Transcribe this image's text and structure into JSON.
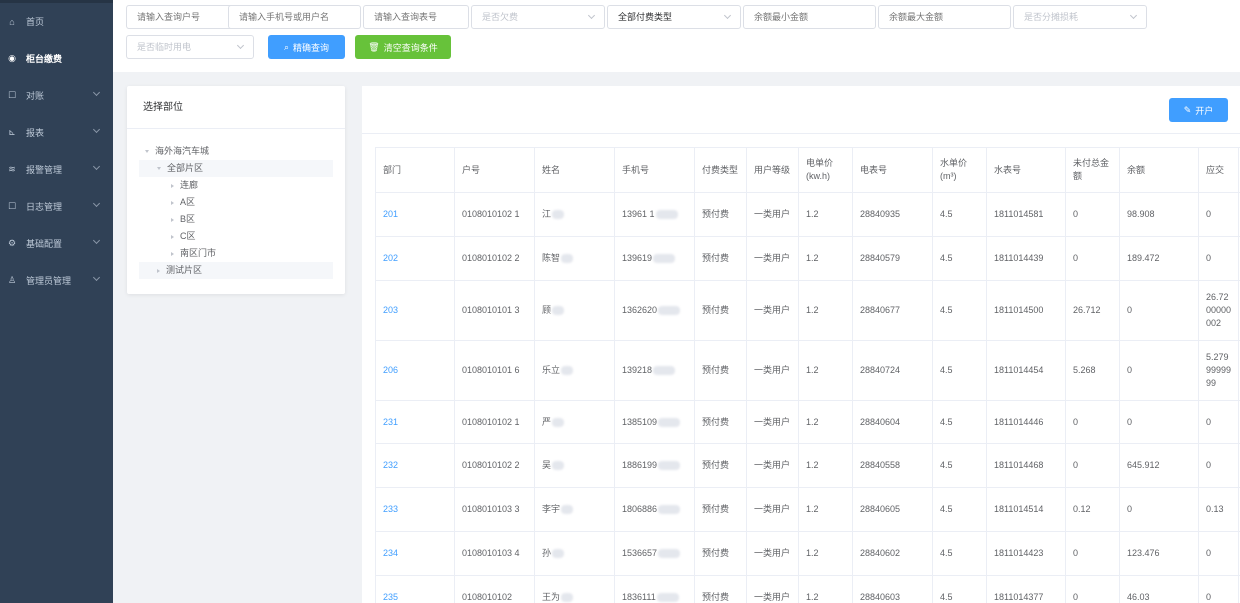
{
  "sidebar": {
    "items": [
      {
        "label": "首页",
        "icon": "dashboard-icon",
        "glyph": "⌂",
        "has_arrow": false,
        "active": false
      },
      {
        "label": "柜台缴费",
        "icon": "counter-icon",
        "glyph": "◉",
        "has_arrow": false,
        "active": true
      },
      {
        "label": "对账",
        "icon": "reconcile-icon",
        "glyph": "☐",
        "has_arrow": true,
        "active": false
      },
      {
        "label": "报表",
        "icon": "report-icon",
        "glyph": "⊾",
        "has_arrow": true,
        "active": false
      },
      {
        "label": "报警管理",
        "icon": "alarm-icon",
        "glyph": "≋",
        "has_arrow": true,
        "active": false
      },
      {
        "label": "日志管理",
        "icon": "log-icon",
        "glyph": "☐",
        "has_arrow": true,
        "active": false
      },
      {
        "label": "基础配置",
        "icon": "config-icon",
        "glyph": "⚙",
        "has_arrow": true,
        "active": false
      },
      {
        "label": "管理员管理",
        "icon": "admin-icon",
        "glyph": "♙",
        "has_arrow": true,
        "active": false
      }
    ]
  },
  "filters": {
    "account_no_placeholder": "请输入查询户号",
    "phone_name_placeholder": "请输入手机号或用户名",
    "meter_no_placeholder": "请输入查询表号",
    "arrears_placeholder": "是否欠费",
    "pay_type_value": "全部付费类型",
    "min_balance_placeholder": "余额最小金额",
    "max_balance_placeholder": "余额最大金额",
    "share_loss_placeholder": "是否分摊损耗",
    "temp_power_placeholder": "是否临时用电",
    "search_label": "精确查询",
    "clear_label": "清空查询条件"
  },
  "tree": {
    "title": "选择部位",
    "root": "海外海汽车城",
    "all_zones": "全部片区",
    "children": [
      "连廊",
      "A区",
      "B区",
      "C区",
      "南区门市"
    ],
    "test_zone": "测试片区"
  },
  "main": {
    "open_account_label": "开户"
  },
  "table": {
    "headers": [
      "部门",
      "户号",
      "姓名",
      "手机号",
      "付费类型",
      "用户等级",
      "电单价(kw.h)",
      "电表号",
      "水单价(m³)",
      "水表号",
      "未付总金额",
      "余额",
      "应交"
    ],
    "rows": [
      {
        "dept": "201",
        "account": "0108010102  1",
        "name": "江",
        "phone": "13961      1",
        "pay_type": "预付费",
        "level": "一类用户",
        "e_price": "1.2",
        "e_meter": "28840935",
        "w_price": "4.5",
        "w_meter": "1811014581",
        "unpaid": "0",
        "balance": "98.908",
        "due": "0"
      },
      {
        "dept": "202",
        "account": "0108010102  2",
        "name": "陈智",
        "phone": "139619",
        "pay_type": "预付费",
        "level": "一类用户",
        "e_price": "1.2",
        "e_meter": "28840579",
        "w_price": "4.5",
        "w_meter": "1811014439",
        "unpaid": "0",
        "balance": "189.472",
        "due": "0"
      },
      {
        "dept": "203",
        "account": "0108010101  3",
        "name": "顾",
        "phone": "1362620",
        "pay_type": "预付费",
        "level": "一类用户",
        "e_price": "1.2",
        "e_meter": "28840677",
        "w_price": "4.5",
        "w_meter": "1811014500",
        "unpaid": "26.712",
        "balance": "0",
        "due": "26.72 00000 002"
      },
      {
        "dept": "206",
        "account": "0108010101  6",
        "name": "乐立",
        "phone": "139218",
        "pay_type": "预付费",
        "level": "一类用户",
        "e_price": "1.2",
        "e_meter": "28840724",
        "w_price": "4.5",
        "w_meter": "1811014454",
        "unpaid": "5.268",
        "balance": "0",
        "due": "5.279 99999 99"
      },
      {
        "dept": "231",
        "account": "0108010102  1",
        "name": "严",
        "phone": "1385109",
        "pay_type": "预付费",
        "level": "一类用户",
        "e_price": "1.2",
        "e_meter": "28840604",
        "w_price": "4.5",
        "w_meter": "1811014446",
        "unpaid": "0",
        "balance": "0",
        "due": "0"
      },
      {
        "dept": "232",
        "account": "0108010102  2",
        "name": "吴",
        "phone": "1886199",
        "pay_type": "预付费",
        "level": "一类用户",
        "e_price": "1.2",
        "e_meter": "28840558",
        "w_price": "4.5",
        "w_meter": "1811014468",
        "unpaid": "0",
        "balance": "645.912",
        "due": "0"
      },
      {
        "dept": "233",
        "account": "0108010103  3",
        "name": "李宇",
        "phone": "1806886",
        "pay_type": "预付费",
        "level": "一类用户",
        "e_price": "1.2",
        "e_meter": "28840605",
        "w_price": "4.5",
        "w_meter": "1811014514",
        "unpaid": "0.12",
        "balance": "0",
        "due": "0.13"
      },
      {
        "dept": "234",
        "account": "0108010103  4",
        "name": "孙",
        "phone": "1536657",
        "pay_type": "预付费",
        "level": "一类用户",
        "e_price": "1.2",
        "e_meter": "28840602",
        "w_price": "4.5",
        "w_meter": "1811014423",
        "unpaid": "0",
        "balance": "123.476",
        "due": "0"
      },
      {
        "dept": "235",
        "account": "0108010102",
        "name": "王为",
        "phone": "1836111",
        "pay_type": "预付费",
        "level": "一类用户",
        "e_price": "1.2",
        "e_meter": "28840603",
        "w_price": "4.5",
        "w_meter": "1811014377",
        "unpaid": "0",
        "balance": "46.03",
        "due": "0"
      }
    ]
  },
  "colors": {
    "sidebar_bg": "#304156",
    "primary": "#409eff",
    "success": "#67c23a"
  }
}
